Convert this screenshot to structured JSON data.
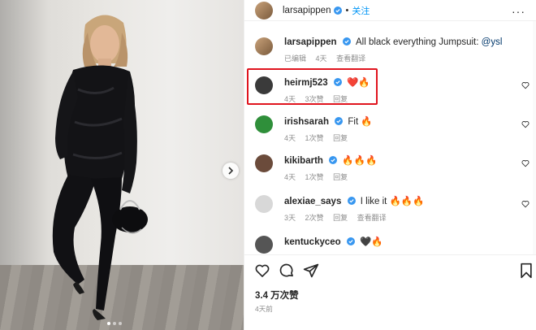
{
  "post": {
    "author": "larsapippen",
    "follow_label": "关注",
    "separator": "•",
    "more_label": "···"
  },
  "caption": {
    "username": "larsapippen",
    "text": "All black everything Jumpsuit: ",
    "mention": "@ysl",
    "edited_label": "已编辑",
    "time": "4天",
    "translate_label": "查看翻译"
  },
  "comments": [
    {
      "username": "heirmj523",
      "text": "❤️🔥",
      "time": "4天",
      "likes": "3次赞",
      "reply": "回复",
      "translate": "",
      "avatar_color": "#3a3a3a"
    },
    {
      "username": "irishsarah",
      "text": "Fit 🔥",
      "time": "4天",
      "likes": "1次赞",
      "reply": "回复",
      "translate": "",
      "avatar_color": "#2f8f3a"
    },
    {
      "username": "kikibarth",
      "text": "🔥🔥🔥",
      "time": "4天",
      "likes": "1次赞",
      "reply": "回复",
      "translate": "",
      "avatar_color": "#6b4b3b"
    },
    {
      "username": "alexiae_says",
      "text": "I like it 🔥🔥🔥",
      "time": "3天",
      "likes": "2次赞",
      "reply": "回复",
      "translate": "查看翻译",
      "avatar_color": "#d8d8d8"
    },
    {
      "username": "kentuckyceo",
      "text": "🖤🔥",
      "time": "",
      "likes": "",
      "reply": "",
      "translate": "",
      "avatar_color": "#555555"
    }
  ],
  "footer": {
    "likes": "3.4 万次赞",
    "date": "4天前"
  },
  "colors": {
    "link": "#0095f6",
    "verified": "#3897f0",
    "highlight_border": "#e0141e",
    "muted_text": "#8e8e8e"
  },
  "icons": {
    "like": "heart-icon",
    "comment": "comment-bubble-icon",
    "share": "paper-plane-icon",
    "save": "bookmark-icon",
    "next": "chevron-right-icon",
    "verified": "verified-badge-icon",
    "more": "more-options-icon"
  }
}
